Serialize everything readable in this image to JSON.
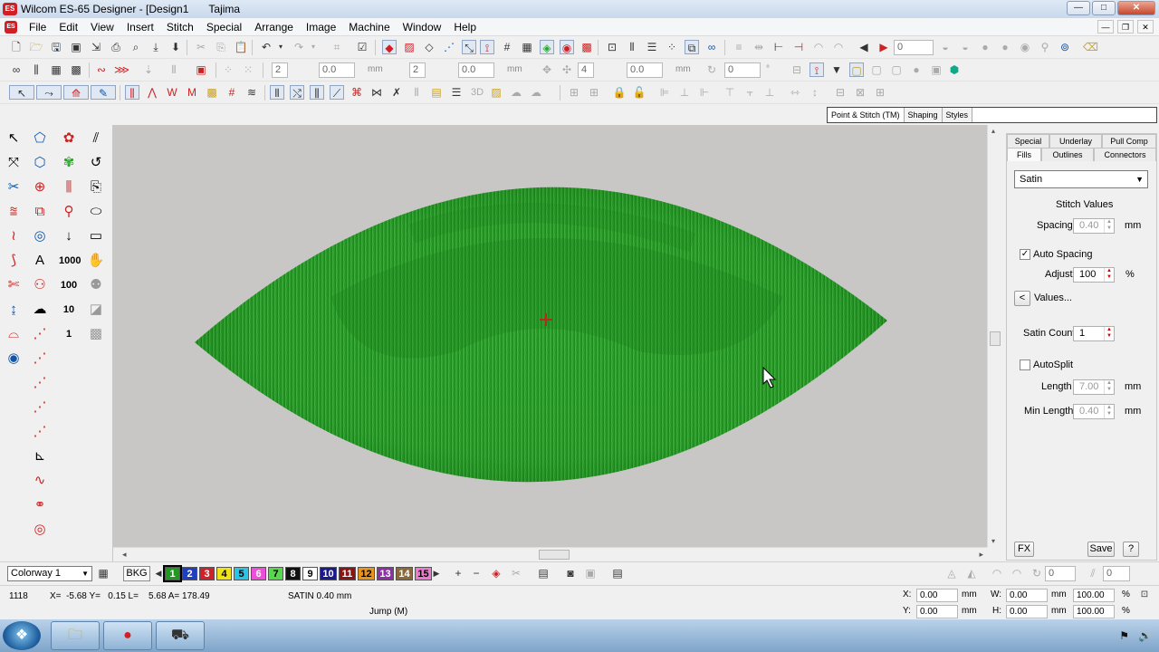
{
  "window": {
    "title": "Wilcom ES-65 Designer - [Design1",
    "machine": "Tajima",
    "minimize": "—",
    "maximize": "□",
    "close": "✕"
  },
  "menu": {
    "items": [
      "File",
      "Edit",
      "View",
      "Insert",
      "Stitch",
      "Special",
      "Arrange",
      "Image",
      "Machine",
      "Window",
      "Help"
    ],
    "mdi": [
      "—",
      "❐",
      "✕"
    ]
  },
  "toolbar1": {
    "hoops_value": "0"
  },
  "toolbar2": {
    "count_a": "2",
    "value_a": "0.0",
    "unit_a": "mm",
    "count_b": "2",
    "value_b": "0.0",
    "unit_b": "mm",
    "count_c": "4",
    "value_c": "0.0",
    "unit_c": "mm",
    "value_d": "0",
    "unit_d": "°"
  },
  "object_tabs": [
    "Point & Stitch (TM)",
    "Shaping",
    "Styles"
  ],
  "panel": {
    "tabs_row1": [
      "Special",
      "Underlay",
      "Pull Comp"
    ],
    "tabs_row2": [
      "Fills",
      "Outlines",
      "Connectors"
    ],
    "fill_type": "Satin",
    "stitch_values_heading": "Stitch Values",
    "spacing_label": "Spacing",
    "spacing_value": "0.40",
    "spacing_unit": "mm",
    "auto_spacing_label": "Auto Spacing",
    "auto_spacing_checked": true,
    "adjust_label": "Adjust",
    "adjust_value": "100",
    "adjust_unit": "%",
    "values_button": "Values...",
    "values_arrow": "<",
    "satin_count_label": "Satin Count",
    "satin_count_value": "1",
    "autosplit_label": "AutoSplit",
    "autosplit_checked": false,
    "length_label": "Length",
    "length_value": "7.00",
    "length_unit": "mm",
    "min_length_label": "Min Length",
    "min_length_value": "0.40",
    "min_length_unit": "mm",
    "fx_button": "FX",
    "save_button": "Save",
    "help_button": "?"
  },
  "colorbar": {
    "colorway": "Colorway 1",
    "bkg": "BKG",
    "swatches": [
      {
        "n": "1",
        "color": "#1e9b1e",
        "text": "#ffffff"
      },
      {
        "n": "2",
        "color": "#1f3fbf",
        "text": "#ffffff"
      },
      {
        "n": "3",
        "color": "#d0202a",
        "text": "#ffffff"
      },
      {
        "n": "4",
        "color": "#f2e318",
        "text": "#000000"
      },
      {
        "n": "5",
        "color": "#27c6e8",
        "text": "#000000"
      },
      {
        "n": "6",
        "color": "#ee4fd8",
        "text": "#ffffff"
      },
      {
        "n": "7",
        "color": "#55d84a",
        "text": "#000000"
      },
      {
        "n": "8",
        "color": "#111111",
        "text": "#ffffff"
      },
      {
        "n": "9",
        "color": "#ffffff",
        "text": "#000000"
      },
      {
        "n": "10",
        "color": "#1a1a8c",
        "text": "#ffffff"
      },
      {
        "n": "11",
        "color": "#8c1414",
        "text": "#ffffff"
      },
      {
        "n": "12",
        "color": "#e8941a",
        "text": "#000000"
      },
      {
        "n": "13",
        "color": "#8e2fa8",
        "text": "#ffffff"
      },
      {
        "n": "14",
        "color": "#8a6a3a",
        "text": "#ffffff"
      },
      {
        "n": "15",
        "color": "#ee7ad0",
        "text": "#000000"
      }
    ],
    "rotation_value": "0",
    "slant_value": "0"
  },
  "status": {
    "stitch_count": "1118",
    "coords": "X=  -5.68 Y=   0.15 L=    5.68 A= 178.49",
    "stitch_type": "SATIN  0.40 mm",
    "jump": "Jump (M)",
    "x_label": "X:",
    "x_value": "0.00",
    "x_unit": "mm",
    "y_label": "Y:",
    "y_value": "0.00",
    "y_unit": "mm",
    "w_label": "W:",
    "w_value": "0.00",
    "w_unit": "mm",
    "w_pct": "100.00",
    "w_pct_unit": "%",
    "h_label": "H:",
    "h_value": "0.00",
    "h_unit": "mm",
    "h_pct": "100.00",
    "h_pct_unit": "%"
  },
  "colors": {
    "fill_green": "#2fa22f",
    "fill_green_dark": "#1f7a1f",
    "canvas_bg": "#c8c7c6",
    "accent_red": "#d21f26"
  }
}
